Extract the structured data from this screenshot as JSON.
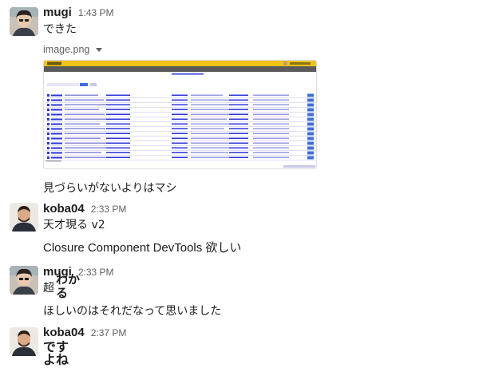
{
  "messages": [
    {
      "user": "mugi",
      "time": "1:43 PM",
      "text": "できた",
      "file": {
        "name": "image.png",
        "caret_icon": "caret-down-icon"
      },
      "followup": "見づらいがないよりはマシ"
    },
    {
      "user": "koba04",
      "time": "2:33 PM",
      "text": "天才現る v2",
      "followup": "Closure Component DevTools 欲しい"
    },
    {
      "user": "mugi",
      "time": "2:33 PM",
      "text": "超",
      "stamp": [
        "わか",
        "る"
      ],
      "followup": "ほしいのはそれだなって思いました"
    },
    {
      "user": "koba04",
      "time": "2:37 PM",
      "emoji_lines": [
        "です",
        "よね"
      ]
    }
  ],
  "colors": {
    "attachment_header": "#f0c419",
    "attachment_link": "#2b36d9",
    "timestamp": "#616061",
    "text": "#1d1c1d"
  }
}
